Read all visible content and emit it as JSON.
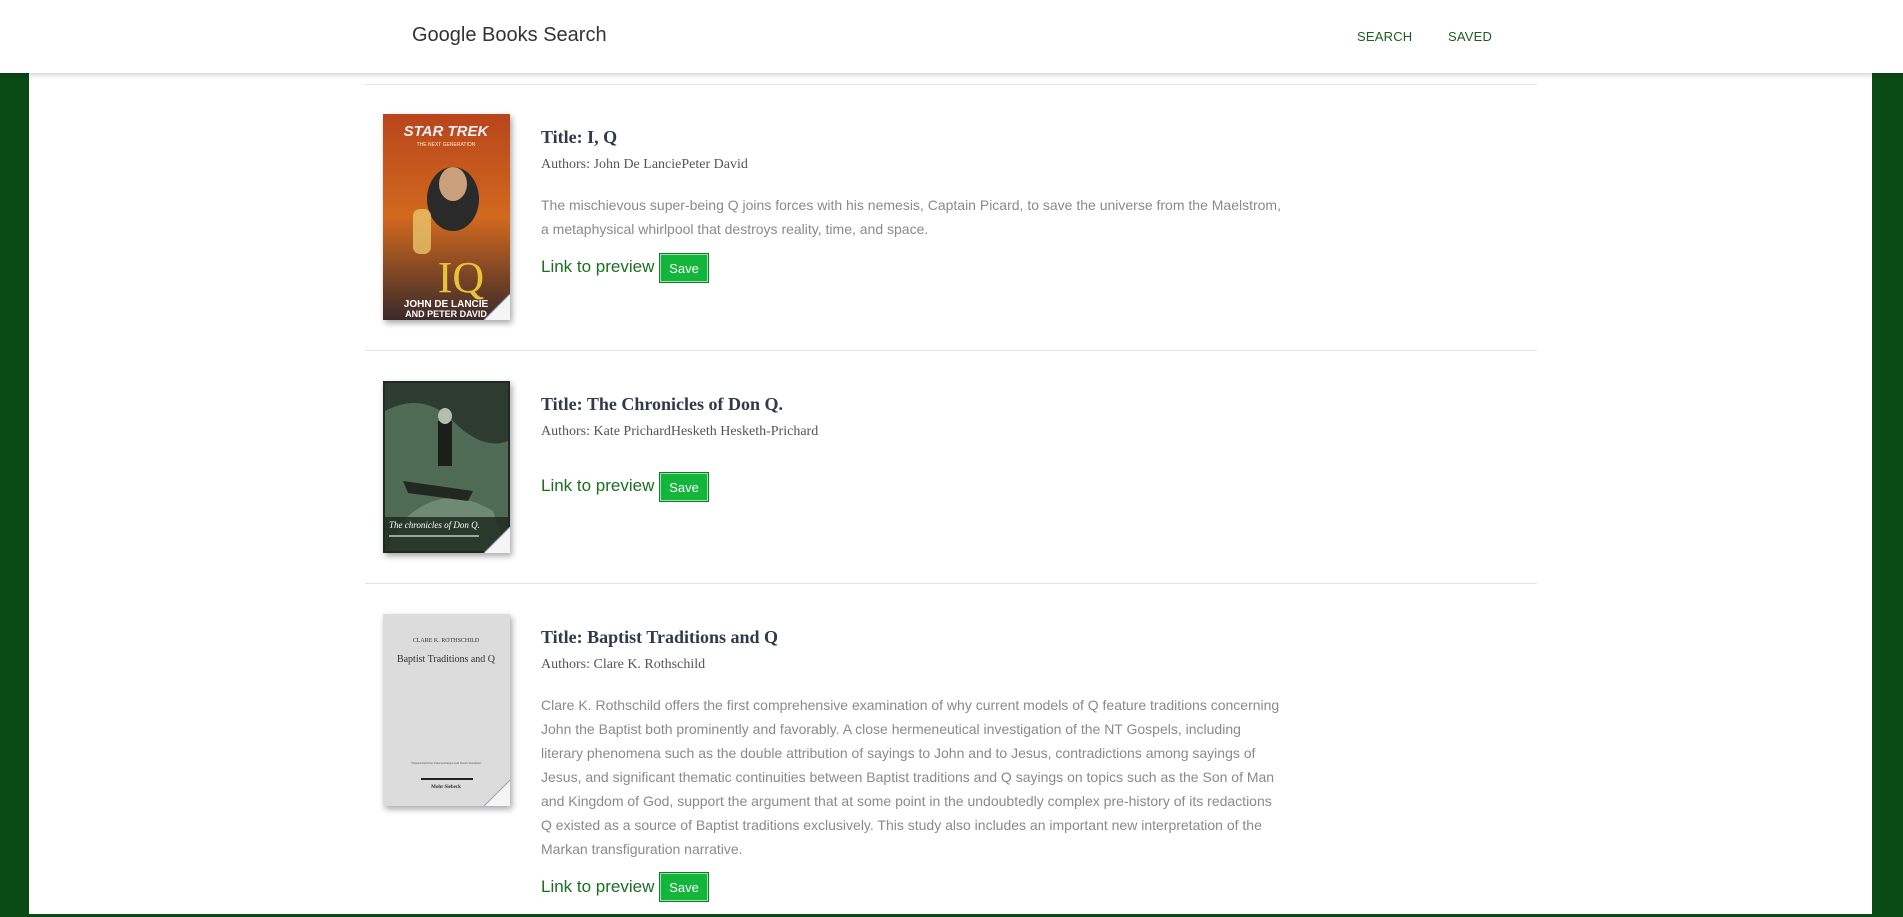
{
  "brand": "Google Books Search",
  "nav": {
    "search": "SEARCH",
    "saved": "SAVED"
  },
  "books": [
    {
      "title": "Title: I, Q",
      "authors": "Authors: John De LanciePeter David",
      "description": "The mischievous super-being Q joins forces with his nemesis, Captain Picard, to save the universe from the Maelstrom, a metaphysical whirlpool that destroys reality, time, and space.",
      "preview": "Link to preview",
      "save": "Save",
      "cover_text": {
        "logo": "STAR TREK",
        "series": "THE NEXT GENERATION",
        "big": "IQ",
        "author1": "JOHN DE LANCIE",
        "author2": "AND PETER DAVID"
      }
    },
    {
      "title": "Title: The Chronicles of Don Q.",
      "authors": "Authors: Kate PrichardHesketh Hesketh-Prichard",
      "description": "",
      "preview": "Link to preview",
      "save": "Save",
      "cover_text": {
        "caption": "The chronicles of Don Q."
      }
    },
    {
      "title": "Title: Baptist Traditions and Q",
      "authors": "Authors: Clare K. Rothschild",
      "description": "Clare K. Rothschild offers the first comprehensive examination of why current models of Q feature traditions concerning John the Baptist both prominently and favorably. A close hermeneutical investigation of the NT Gospels, including literary phenomena such as the double attribution of sayings to John and to Jesus, contradictions among sayings of Jesus, and significant thematic continuities between Baptist traditions and Q sayings on topics such as the Son of Man and Kingdom of God, support the argument that at some point in the undoubtedly complex pre-history of its redactions Q existed as a source of Baptist traditions exclusively. This study also includes an important new interpretation of the Markan transfiguration narrative.",
      "preview": "Link to preview",
      "save": "Save",
      "cover_text": {
        "author": "CLARE K. ROTHSCHILD",
        "title": "Baptist Traditions and Q",
        "series": "Wissenschaftliche Untersuchungen zum Neuen Testament",
        "publisher": "Mohr Siebeck"
      }
    }
  ]
}
